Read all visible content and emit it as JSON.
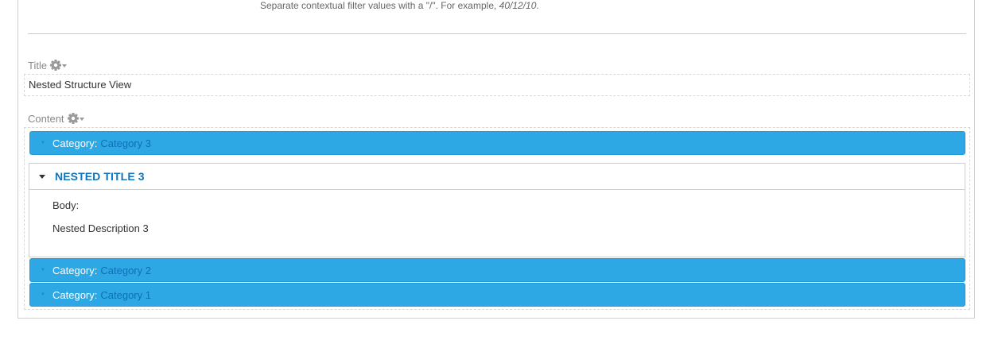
{
  "help": {
    "text": "Separate contextual filter values with a \"/\". For example, ",
    "example": "40/12/10",
    "end": "."
  },
  "title_field": {
    "label": "Title",
    "value": "Nested Structure View",
    "settings_icon": "gear-icon"
  },
  "content_field": {
    "label": "Content",
    "settings_icon": "gear-icon"
  },
  "categories": [
    {
      "prefix": "Category:",
      "value": "Category 3"
    },
    {
      "prefix": "Category:",
      "value": "Category 2"
    },
    {
      "prefix": "Category:",
      "value": "Category 1"
    }
  ],
  "nested": {
    "title": "NESTED TITLE 3",
    "body_label": "Body:",
    "body_text": "Nested Description 3"
  },
  "colors": {
    "accordion_header": "#2ea8e4",
    "category_value": "#0d6fb8",
    "nested_title": "#0f75bc"
  }
}
